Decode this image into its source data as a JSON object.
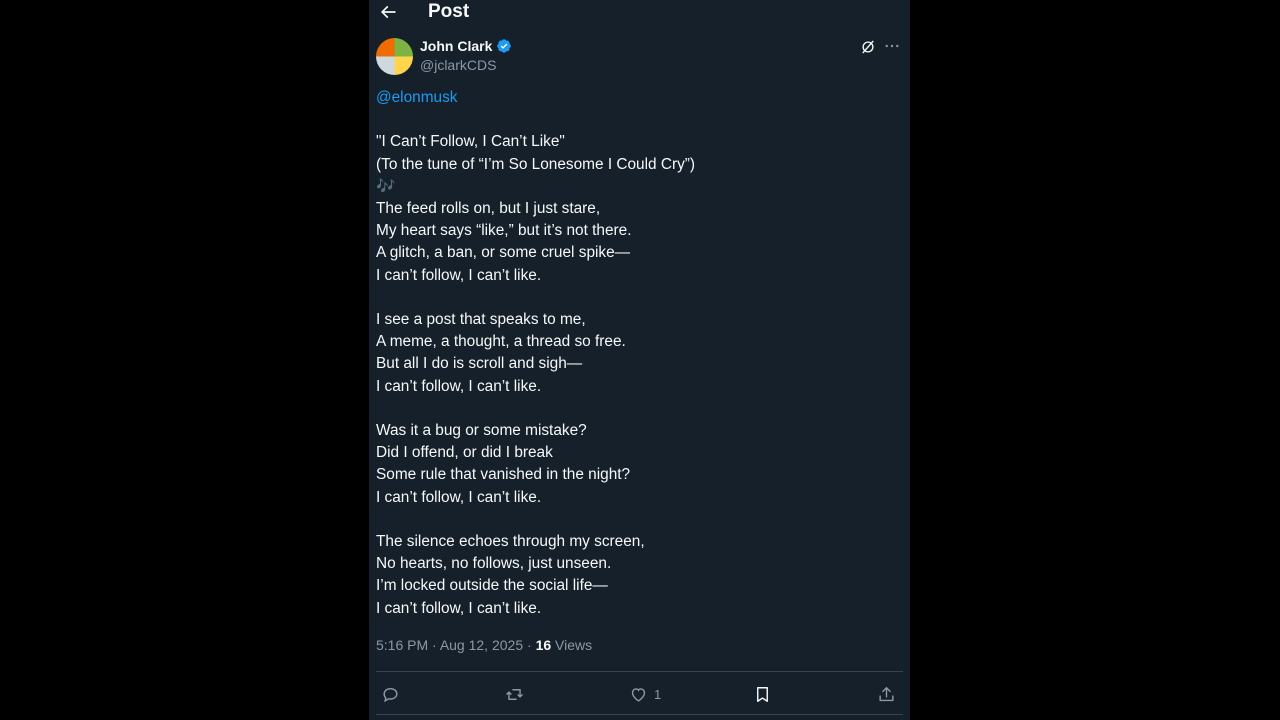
{
  "header": {
    "title": "Post",
    "back_icon": "arrow-left-icon"
  },
  "author": {
    "name": "John Clark",
    "handle": "@jclarkCDS",
    "verified_icon": "verified-badge-icon",
    "verified_color": "#1d9bf0"
  },
  "post": {
    "mention": "@elonmusk",
    "title_line": "\"I Can’t Follow, I Can’t Like\"",
    "tune_line": "(To the tune of “I’m So Lonesome I Could Cry”)",
    "notes_emoji": "🎶",
    "verses": [
      [
        "The feed rolls on, but I just stare,",
        "My heart says “like,” but it’s not there.",
        "A glitch, a ban, or some cruel spike—",
        "I can’t follow, I can’t like."
      ],
      [
        "I see a post that speaks to me,",
        "A meme, a thought, a thread so free.",
        "But all I do is scroll and sigh—",
        "I can’t follow, I can’t like."
      ],
      [
        "Was it a bug or some mistake?",
        "Did I offend, or did I break",
        "Some rule that vanished in the night?",
        "I can’t follow, I can’t like."
      ],
      [
        "The silence echoes through my screen,",
        "No hearts, no follows, just unseen.",
        "I’m locked outside the social life—",
        "I can’t follow, I can’t like."
      ]
    ]
  },
  "meta": {
    "time": "5:16 PM",
    "date": "Aug 12, 2025",
    "views_count": "16",
    "views_label": "Views"
  },
  "actions": {
    "likes": "1"
  },
  "colors": {
    "background": "#15202b",
    "text": "#f7f9f9",
    "muted": "#8b98a5",
    "accent": "#1d9bf0"
  }
}
